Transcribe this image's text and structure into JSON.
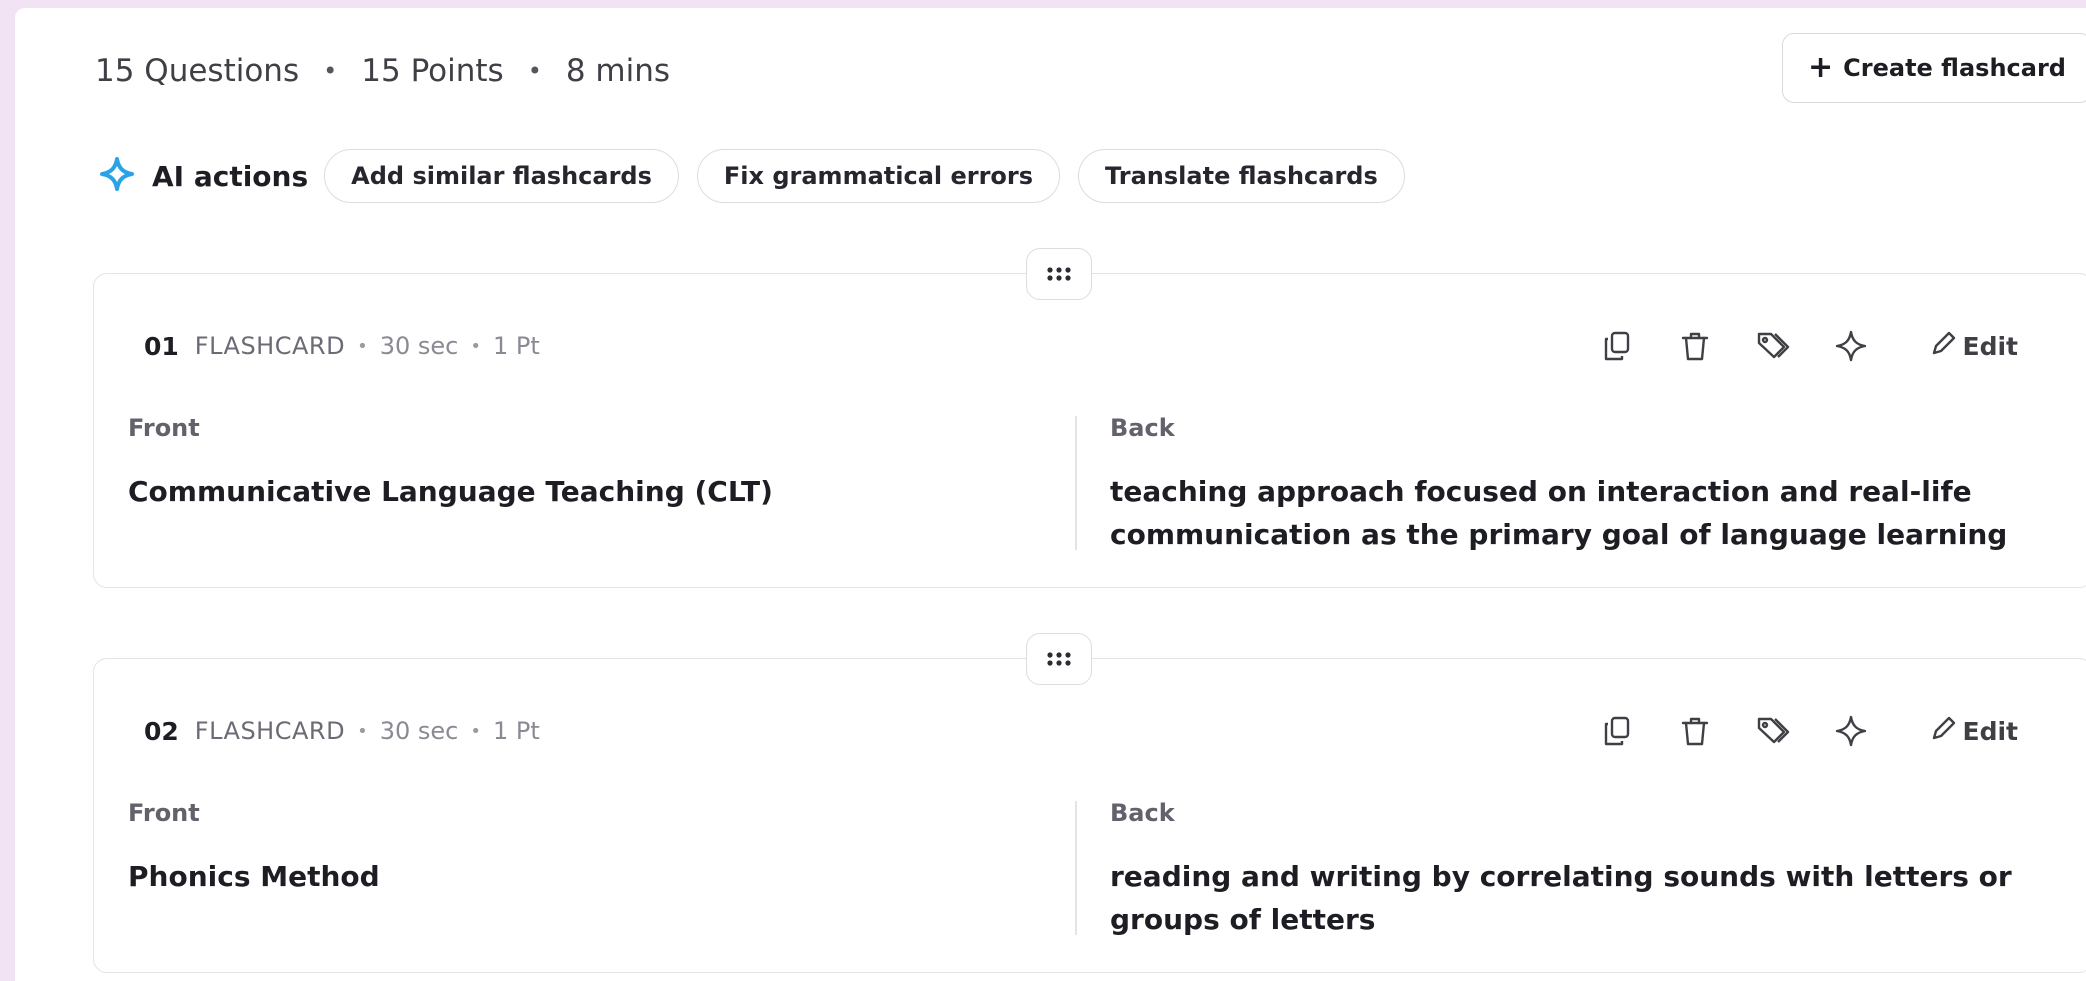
{
  "summary": {
    "questions": "15 Questions",
    "points": "15 Points",
    "duration": "8 mins",
    "separator": "•"
  },
  "create_button": {
    "label": "Create flashcard",
    "icon": "plus-icon",
    "plus": "+"
  },
  "ai_actions": {
    "label": "AI actions",
    "icon": "sparkle-icon",
    "accent_color": "#29a3e8",
    "chips": [
      "Add similar flashcards",
      "Fix grammatical errors",
      "Translate flashcards"
    ]
  },
  "cards": [
    {
      "number": "01",
      "type": "FLASHCARD",
      "time": "30 sec",
      "points": "1 Pt",
      "front_label": "Front",
      "front_text": "Communicative Language Teaching (CLT)",
      "back_label": "Back",
      "back_text": "teaching approach focused on interaction and real-life communication as the primary goal of language learning",
      "edit_label": "Edit"
    },
    {
      "number": "02",
      "type": "FLASHCARD",
      "time": "30 sec",
      "points": "1 Pt",
      "front_label": "Front",
      "front_text": "Phonics Method",
      "back_label": "Back",
      "back_text": "reading and writing by correlating sounds with letters or groups of letters",
      "edit_label": "Edit"
    }
  ],
  "card_tool_icons": [
    "copy-icon",
    "trash-icon",
    "tag-icon",
    "sparkle-icon",
    "pencil-icon"
  ],
  "colors": {
    "background": "#f1e3f4",
    "panel": "#ffffff",
    "border": "#e3e3e8",
    "text": "#1d1d24"
  }
}
